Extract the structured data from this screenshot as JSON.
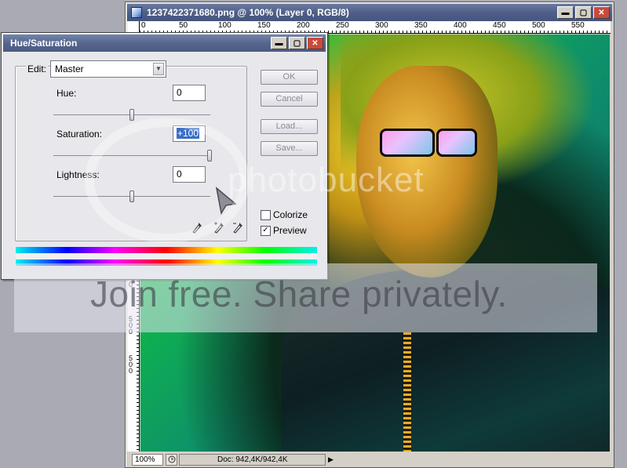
{
  "document_window": {
    "title": "1237422371680.png @ 100% (Layer 0, RGB/8)",
    "buttons": {
      "minimize": "▬",
      "maximize": "▢",
      "close": "✕"
    },
    "ruler_top": [
      "0",
      "50",
      "100",
      "150",
      "200",
      "250",
      "300",
      "350",
      "400",
      "450",
      "500",
      "550"
    ],
    "ruler_left": [
      "0",
      "5",
      "0",
      "0",
      "5",
      "0",
      "0"
    ],
    "status": {
      "zoom": "100%",
      "doc_info": "Doc: 942,4K/942,4K",
      "arrow": "▶"
    }
  },
  "dialog": {
    "title": "Hue/Saturation",
    "edit_label": "Edit:",
    "edit_value": "Master",
    "hue_label": "Hue:",
    "hue_value": "0",
    "saturation_label": "Saturation:",
    "saturation_value": "+100",
    "lightness_label": "Lightness:",
    "lightness_value": "0",
    "sliders": {
      "hue": 0,
      "saturation": 100,
      "lightness": 0
    },
    "buttons": {
      "ok": "OK",
      "cancel": "Cancel",
      "load": "Load...",
      "save": "Save..."
    },
    "colorize_label": "Colorize",
    "colorize_checked": false,
    "preview_label": "Preview",
    "preview_checked": true,
    "preview_check_glyph": "✓",
    "eyedroppers": [
      "eyedropper-icon",
      "eyedropper-plus-icon",
      "eyedropper-minus-icon"
    ]
  },
  "watermark": {
    "brand": "photobucket",
    "banner": "Join free. Share privately."
  }
}
